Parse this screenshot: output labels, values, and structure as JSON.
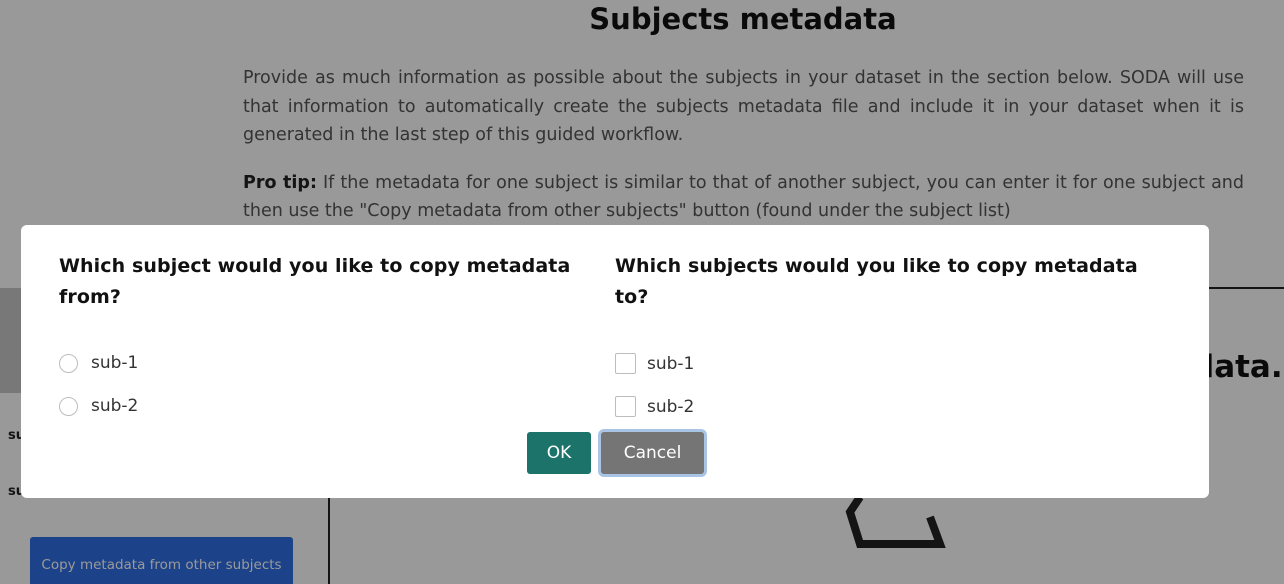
{
  "background": {
    "page_title": "Subjects metadata",
    "intro_paragraph": "Provide as much information as possible about the subjects in your dataset in the section below. SODA will use that information to automatically create the subjects metadata file and include it in your dataset when it is generated in the last step of this guided workflow.",
    "pro_tip_label": "Pro tip:",
    "pro_tip_text": " If the metadata for one subject is similar to that of another subject, you can enter it for one subject and then use the \"Copy metadata from other subjects\" button (found under the subject list)",
    "subject_entries": [
      "su",
      "su"
    ],
    "copy_button_label": "Copy metadata from other subjects",
    "right_heading_partial": "data."
  },
  "dialog": {
    "from_question": "Which subject would you like to copy metadata from?",
    "from_options": [
      "sub-1",
      "sub-2"
    ],
    "to_question": "Which subjects would you like to copy metadata to?",
    "to_options": [
      "sub-1",
      "sub-2"
    ],
    "ok_label": "OK",
    "cancel_label": "Cancel"
  },
  "colors": {
    "ok_button": "#1c7369",
    "cancel_button": "#757575",
    "copy_button": "#2f6fe4",
    "overlay": "rgba(0,0,0,0.4)"
  }
}
